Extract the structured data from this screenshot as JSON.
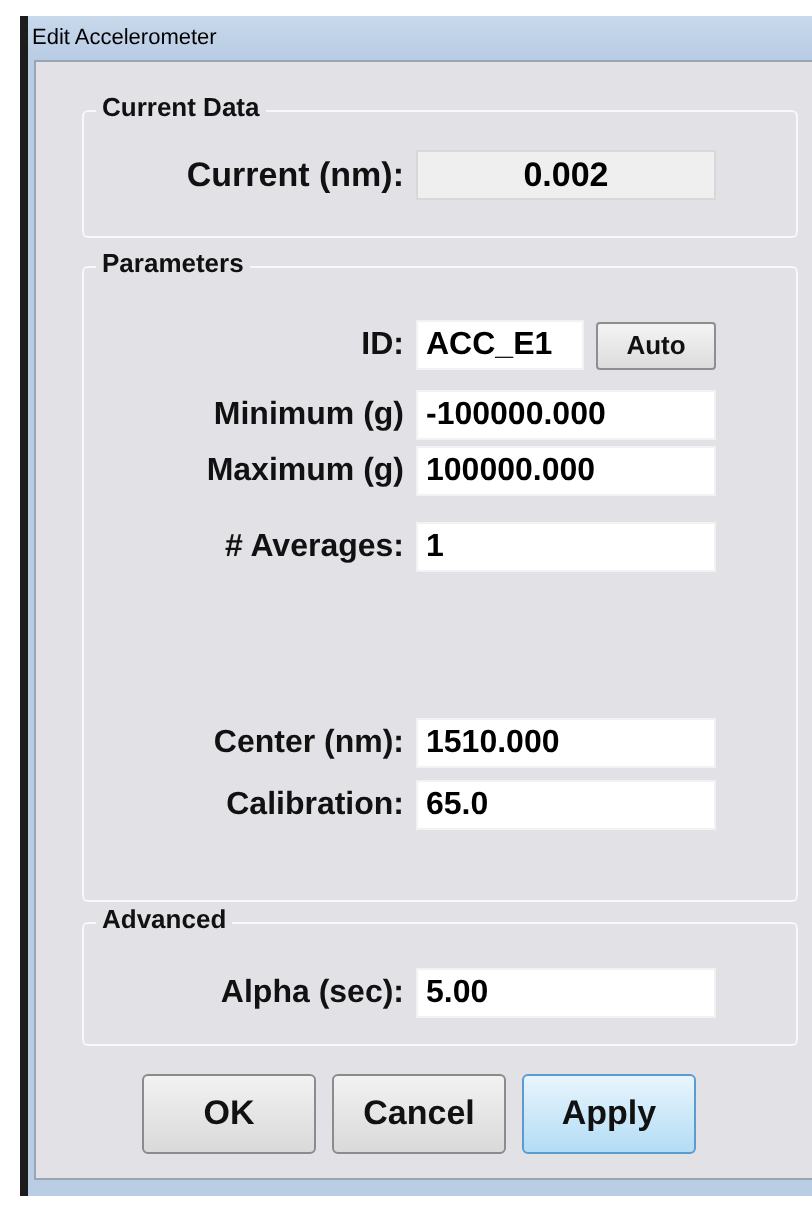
{
  "window": {
    "title": "Edit Accelerometer"
  },
  "groups": [
    {
      "title": "Current Data",
      "fields": [
        {
          "label": "Current (nm):",
          "value": "0.002",
          "readonly": true
        }
      ]
    },
    {
      "title": "Parameters",
      "fields": [
        {
          "label": "ID:",
          "value": "ACC_E1",
          "readonly": false,
          "button": "Auto"
        },
        {
          "label": "Minimum (g)",
          "value": "-100000.000",
          "readonly": false
        },
        {
          "label": "Maximum (g)",
          "value": "100000.000",
          "readonly": false
        },
        {
          "label": "# Averages:",
          "value": "1",
          "readonly": false
        },
        {
          "label": "Center (nm):",
          "value": "1510.000",
          "readonly": false
        },
        {
          "label": "Calibration:",
          "value": "65.0",
          "readonly": false
        }
      ]
    },
    {
      "title": "Advanced",
      "fields": [
        {
          "label": "Alpha (sec):",
          "value": "5.00",
          "readonly": false
        }
      ]
    }
  ],
  "buttons": [
    {
      "label": "OK",
      "default": false
    },
    {
      "label": "Cancel",
      "default": false
    },
    {
      "label": "Apply",
      "default": true
    }
  ]
}
